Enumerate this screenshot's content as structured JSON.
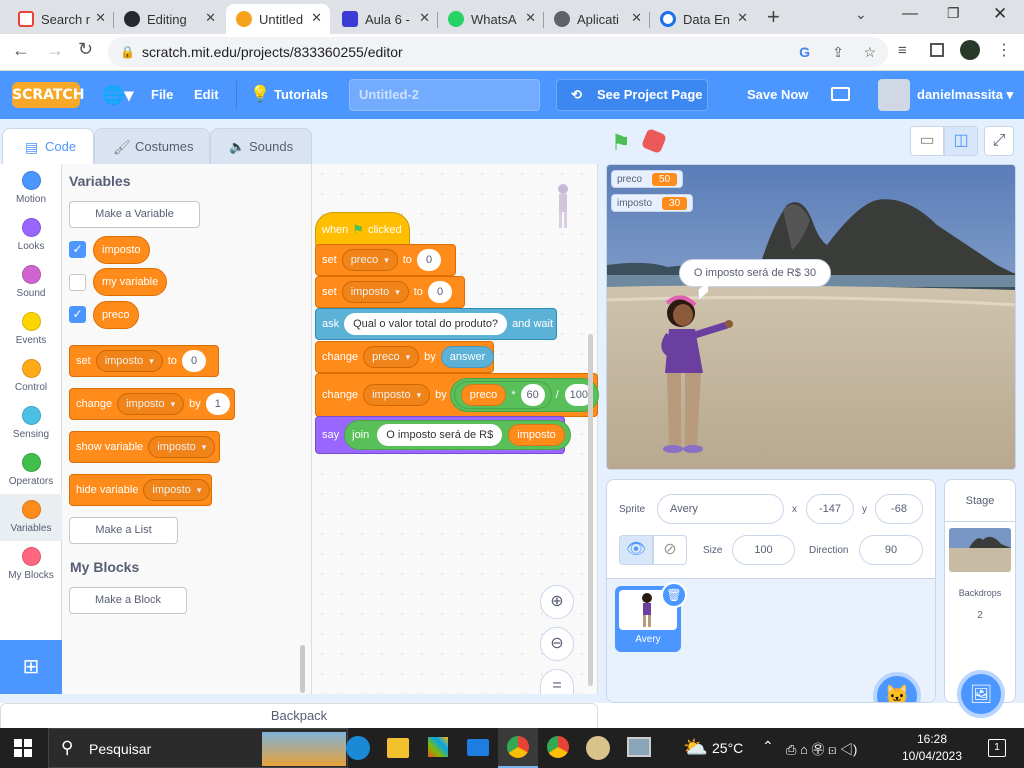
{
  "browser": {
    "tabs": [
      {
        "label": "Search r",
        "color": "#ea4335"
      },
      {
        "label": "Editing",
        "color": "#24292f"
      },
      {
        "label": "Untitled",
        "color": "#f6a21d"
      },
      {
        "label": "Aula 6 -",
        "color": "#3b3bd6"
      },
      {
        "label": "WhatsA",
        "color": "#25d366"
      },
      {
        "label": "Aplicati",
        "color": "#5f6368"
      },
      {
        "label": "Data En",
        "color": "#1a73e8"
      }
    ],
    "new_tab": "+",
    "url": "scratch.mit.edu/projects/833360255/editor"
  },
  "menubar": {
    "logo": "SCRATCH",
    "file": "File",
    "edit": "Edit",
    "tutorials": "Tutorials",
    "project_title": "Untitled-2",
    "see_project": "See Project Page",
    "save_now": "Save Now",
    "username": "danielmassita"
  },
  "editor_tabs": {
    "code": "Code",
    "costumes": "Costumes",
    "sounds": "Sounds"
  },
  "categories": [
    {
      "label": "Motion",
      "color": "#4c97ff"
    },
    {
      "label": "Looks",
      "color": "#9966ff"
    },
    {
      "label": "Sound",
      "color": "#cf63cf"
    },
    {
      "label": "Events",
      "color": "#ffd500"
    },
    {
      "label": "Control",
      "color": "#ffab19"
    },
    {
      "label": "Sensing",
      "color": "#4cbfe6"
    },
    {
      "label": "Operators",
      "color": "#40bf4a"
    },
    {
      "label": "Variables",
      "color": "#ff8c1a"
    },
    {
      "label": "My Blocks",
      "color": "#ff6680"
    }
  ],
  "palette": {
    "heading": "Variables",
    "make_variable": "Make a Variable",
    "vars": [
      {
        "name": "imposto",
        "checked": true
      },
      {
        "name": "my variable",
        "checked": false
      },
      {
        "name": "preco",
        "checked": true
      }
    ],
    "set_block": {
      "word": "set",
      "var": "imposto",
      "to": "to",
      "val": "0"
    },
    "change_block": {
      "word": "change",
      "var": "imposto",
      "by": "by",
      "val": "1"
    },
    "show_block": {
      "word": "show variable",
      "var": "imposto"
    },
    "hide_block": {
      "word": "hide variable",
      "var": "imposto"
    },
    "make_list": "Make a List",
    "myblocks_heading": "My Blocks",
    "make_block": "Make a Block"
  },
  "script": {
    "hat": {
      "when": "when",
      "clicked": "clicked"
    },
    "set1": {
      "word": "set",
      "var": "preco",
      "to": "to",
      "val": "0"
    },
    "set2": {
      "word": "set",
      "var": "imposto",
      "to": "to",
      "val": "0"
    },
    "ask": {
      "word": "ask",
      "question": "Qual o valor total do produto?",
      "wait": "and wait"
    },
    "change1": {
      "word": "change",
      "var": "preco",
      "by": "by",
      "rep": "answer"
    },
    "change2": {
      "word": "change",
      "var": "imposto",
      "by": "by",
      "a": "preco",
      "mul": "*",
      "b": "60",
      "div": "/",
      "c": "100"
    },
    "say": {
      "word": "say",
      "join": "join",
      "text": "O imposto será de R$",
      "var": "imposto"
    }
  },
  "stage": {
    "monitors": [
      {
        "name": "preco",
        "value": "50"
      },
      {
        "name": "imposto",
        "value": "30"
      }
    ],
    "speech": "O imposto será de R$ 30"
  },
  "sprite_info": {
    "sprite_label": "Sprite",
    "sprite_name": "Avery",
    "x_label": "x",
    "x": "-147",
    "y_label": "y",
    "y": "-68",
    "show_label": "Show",
    "size_label": "Size",
    "size": "100",
    "direction_label": "Direction",
    "direction": "90",
    "thumb_name": "Avery"
  },
  "stage_pane": {
    "title": "Stage",
    "backdrops_label": "Backdrops",
    "backdrops_count": "2"
  },
  "backpack": "Backpack",
  "taskbar": {
    "search": "Pesquisar",
    "weather": "25°C",
    "time": "16:28",
    "date": "10/04/2023",
    "notifications": "1"
  }
}
